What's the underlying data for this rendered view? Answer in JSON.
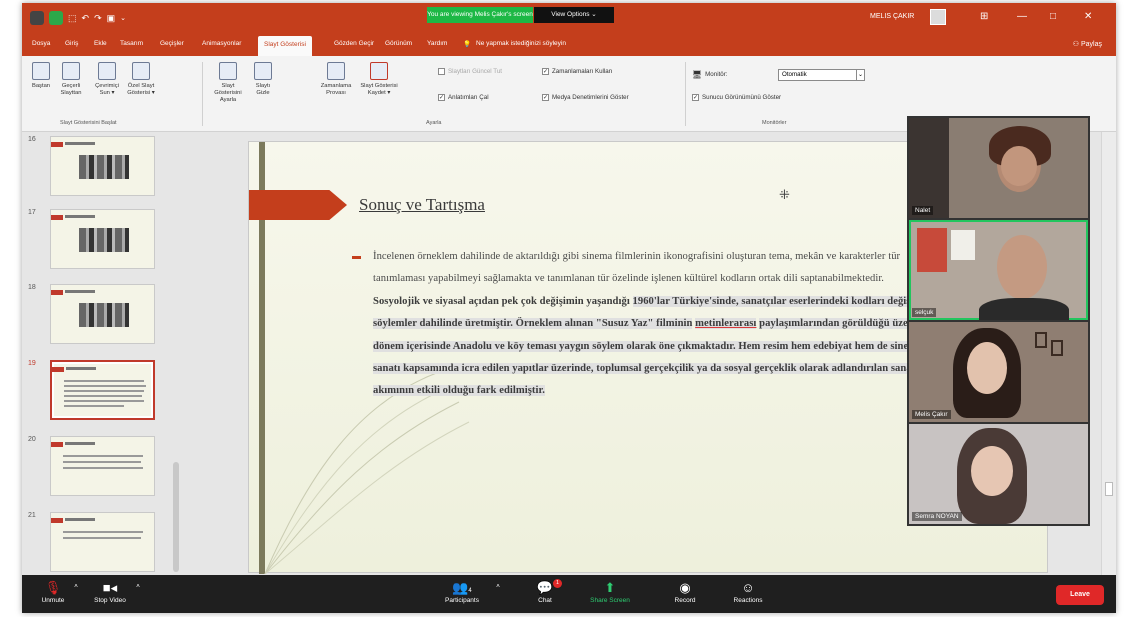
{
  "titlebar": {
    "banner": "You are viewing Melis Çakır's screen",
    "view_options": "View Options ⌄",
    "username": "MELIS ÇAKIR",
    "minimize": "—",
    "maximize": "□",
    "close": "✕",
    "ribbon_toggle": "⊞"
  },
  "tabs": [
    "Dosya",
    "Giriş",
    "Ekle",
    "Tasarım",
    "Geçişler",
    "Animasyonlar",
    "Slayt Gösterisi",
    "Gözden Geçir",
    "Görünüm",
    "Yardım"
  ],
  "tell_me": "Ne yapmak istediğinizi söyleyin",
  "share": "Paylaş",
  "ribbon": {
    "group_start": {
      "label": "Slayt Gösterisini Başlat",
      "buttons": [
        "Baştan",
        "Geçerli Slayttan",
        "Çevrimiçi Sun ▾",
        "Özel Slayt Gösterisi ▾"
      ]
    },
    "group_setup": {
      "label": "Ayarla",
      "buttons": [
        "Slayt Gösterisini Ayarla",
        "Slaytı Gizle",
        "Zamanlama Provası",
        "Slayt Gösterisi Kaydet ▾"
      ],
      "checks": [
        {
          "label": "Slaytları Güncel Tut",
          "checked": false,
          "disabled": true
        },
        {
          "label": "Anlatımları Çal",
          "checked": true,
          "disabled": false
        },
        {
          "label": "Zamanlamaları Kullan",
          "checked": true,
          "disabled": false
        },
        {
          "label": "Medya Denetimlerini Göster",
          "checked": true,
          "disabled": false
        }
      ]
    },
    "group_monitors": {
      "label": "Monitörler",
      "monitor_label": "Monitör:",
      "monitor_value": "Otomatik",
      "presenter_view": "Sunucu Görünümünü Göster"
    }
  },
  "thumbnails": [
    {
      "num": "16",
      "selected": false
    },
    {
      "num": "17",
      "selected": false
    },
    {
      "num": "18",
      "selected": false
    },
    {
      "num": "19",
      "selected": true
    },
    {
      "num": "20",
      "selected": false
    },
    {
      "num": "21",
      "selected": false
    }
  ],
  "slide": {
    "title": "Sonuç ve Tartışma",
    "para_plain": "İncelenen örneklem dahilinde de aktarıldığı gibi sinema filmlerinin ikonografisini oluşturan tema, mekân ve karakterler tür tanımlaması yapabilmeyi sağlamakta ve tanımlanan tür özelinde işlenen kültürel kodların ortak dili saptanabilmektedir.",
    "para_bold_1": "Sosyolojik ve siyasal açıdan pek çok değişimin yaşandığı",
    "para_bold_hl": "1960'lar Türkiye'sinde, sanatçılar eserlerindeki kodları değişen söylemler dahilinde üretmiştir. Örneklem alınan \"Susuz Yaz\" filminin",
    "para_bold_ul": "metinlerarası",
    "para_bold_2": "paylaşımlarından görüldüğü üzere, dönem içerisinde Anadolu ve köy teması yaygın söylem olarak öne çıkmaktadır. Hem resim hem edebiyat hem de sinema sanatı kapsamında icra edilen yapıtlar üzerinde, toplumsal gerçekçilik ya da sosyal gerçeklik olarak adlandırılan sanat akımının etkili olduğu fark edilmiştir."
  },
  "participants": [
    {
      "name": "Nalet",
      "active": false,
      "bg": "#9a8f86"
    },
    {
      "name": "selçuk",
      "active": true,
      "bg": "#b2a79c"
    },
    {
      "name": "Melis Çakır",
      "active": false,
      "bg": "#8f7e72"
    },
    {
      "name": "Semra NOYAN",
      "active": false,
      "bg": "#c8c3c2"
    }
  ],
  "zoombar": {
    "unmute": "Unmute",
    "stop_video": "Stop Video",
    "participants": "Participants",
    "participants_count": "4",
    "chat": "Chat",
    "chat_badge": "1",
    "share_screen": "Share Screen",
    "record": "Record",
    "reactions": "Reactions",
    "leave": "Leave"
  },
  "colors": {
    "accent": "#c43e1c",
    "zoom_green": "#2ecc71",
    "leave_red": "#e02828"
  }
}
